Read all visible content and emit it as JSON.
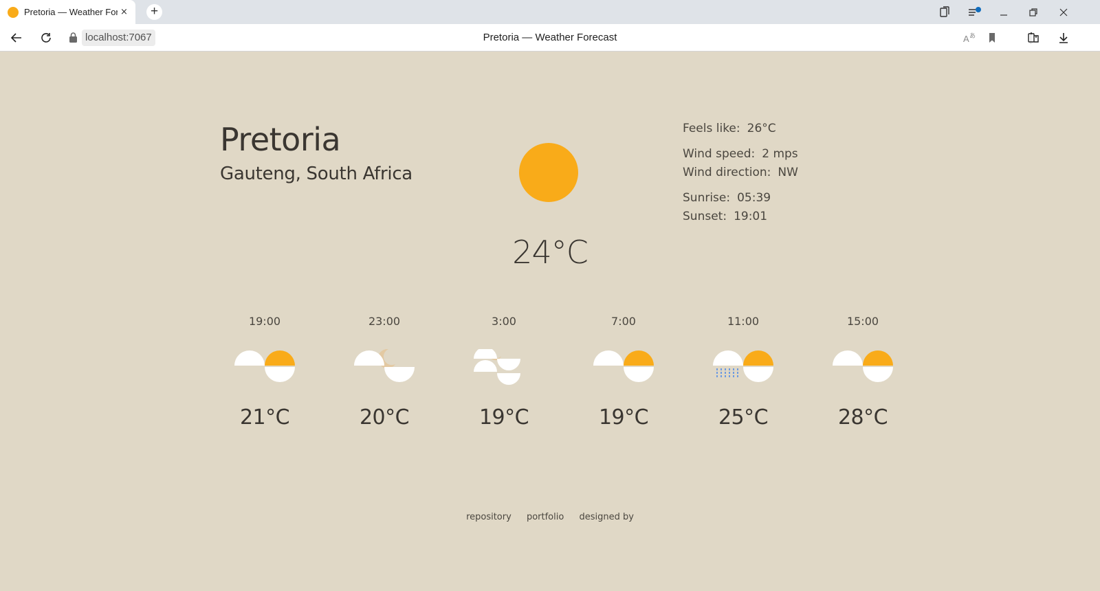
{
  "browser": {
    "tab_title": "Pretoria — Weather Forecast",
    "tab_close": "×",
    "new_tab": "+",
    "url": "localhost:7067",
    "page_title": "Pretoria — Weather Forecast"
  },
  "colors": {
    "background": "#e0d8c6",
    "sun": "#f9ab19",
    "cloud": "#ffffff",
    "moon": "#e3c9a2",
    "rain": "#6f9be0",
    "text": "#3a3631"
  },
  "location": {
    "city": "Pretoria",
    "region": "Gauteng, South Africa"
  },
  "current": {
    "icon": "sun-icon",
    "temperature": "24°C"
  },
  "details": {
    "feels_like_label": "Feels like:",
    "feels_like_value": "26°C",
    "wind_speed_label": "Wind speed:",
    "wind_speed_value": "2 mps",
    "wind_direction_label": "Wind direction:",
    "wind_direction_value": "NW",
    "sunrise_label": "Sunrise:",
    "sunrise_value": "05:39",
    "sunset_label": "Sunset:",
    "sunset_value": "19:01"
  },
  "forecast": [
    {
      "time": "19:00",
      "temp": "21°C",
      "icon": "cloud-sun-icon"
    },
    {
      "time": "23:00",
      "temp": "20°C",
      "icon": "cloud-moon-icon"
    },
    {
      "time": "3:00",
      "temp": "19°C",
      "icon": "clouds-moon-icon"
    },
    {
      "time": "7:00",
      "temp": "19°C",
      "icon": "cloud-sun-icon"
    },
    {
      "time": "11:00",
      "temp": "25°C",
      "icon": "rain-sun-icon"
    },
    {
      "time": "15:00",
      "temp": "28°C",
      "icon": "cloud-sun-icon"
    }
  ],
  "footer": {
    "repository": "repository",
    "portfolio": "portfolio",
    "designed_by": "designed by"
  }
}
